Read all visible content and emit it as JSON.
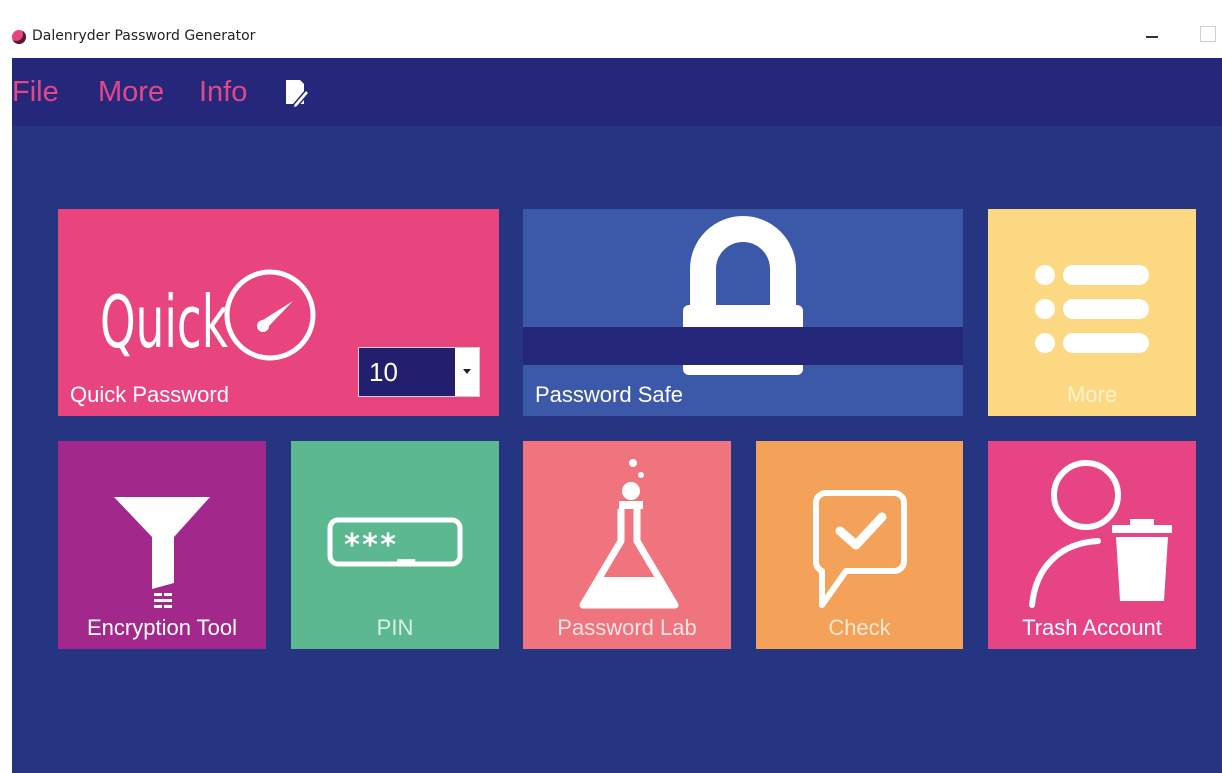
{
  "window": {
    "title": "Dalenryder Password Generator"
  },
  "menu": {
    "file": "File",
    "more": "More",
    "info": "Info",
    "icon": "notepad-icon"
  },
  "tiles": {
    "quick": {
      "logo_text": "Quick",
      "label": "Quick Password",
      "length_value": "10",
      "color": "#e8457e",
      "icon": "speedometer-icon"
    },
    "safe": {
      "label": "Password Safe",
      "color": "#3b59a8",
      "icon": "lock-icon"
    },
    "more": {
      "label": "More",
      "color": "#fdd882",
      "icon": "list-icon"
    },
    "encryption": {
      "label": "Encryption Tool",
      "color": "#a3288b",
      "icon": "funnel-icon"
    },
    "pin": {
      "label": "PIN",
      "mask": "***_",
      "color": "#5cb98f",
      "icon": "pin-field-icon"
    },
    "lab": {
      "label": "Password Lab",
      "color": "#ef747d",
      "icon": "flask-icon"
    },
    "check": {
      "label": "Check",
      "color": "#f4a25a",
      "icon": "check-bubble-icon"
    },
    "trash": {
      "label": "Trash Account",
      "color": "#e64485",
      "icon": "user-trash-icon"
    }
  }
}
